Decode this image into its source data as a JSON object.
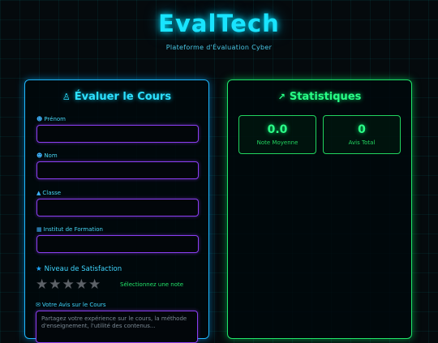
{
  "header": {
    "title": "EvalTech",
    "subtitle": "Plateforme d'Évaluation Cyber"
  },
  "form": {
    "title": "Évaluer le Cours",
    "fields": [
      {
        "label": "Prénom",
        "value": ""
      },
      {
        "label": "Nom",
        "value": ""
      },
      {
        "label": "Classe",
        "value": ""
      },
      {
        "label": "Institut de Formation",
        "value": ""
      }
    ],
    "satisfaction": {
      "label": "Niveau de Satisfaction",
      "hint": "Sélectionnez une note",
      "rating": 0,
      "max": 5
    },
    "review": {
      "label": "Votre Avis sur le Cours",
      "placeholder": "Partagez votre expérience sur le cours, la méthode d'enseignement, l'utilité des contenus..."
    }
  },
  "stats": {
    "title": "Statistiques",
    "average": {
      "value": "0.0",
      "label": "Note Moyenne"
    },
    "total": {
      "value": "0",
      "label": "Avis Total"
    }
  },
  "colors": {
    "accent_cyan": "#19e4ff",
    "accent_green": "#21e66a",
    "input_border": "#8a3ef0"
  },
  "icons": {
    "form_title": "teacher-icon",
    "stats_title": "chart-icon",
    "first_name": "user-icon",
    "last_name": "user-icon",
    "class": "graduation-cap-icon",
    "institute": "building-icon",
    "satisfaction": "star-icon",
    "review": "comment-icon"
  }
}
